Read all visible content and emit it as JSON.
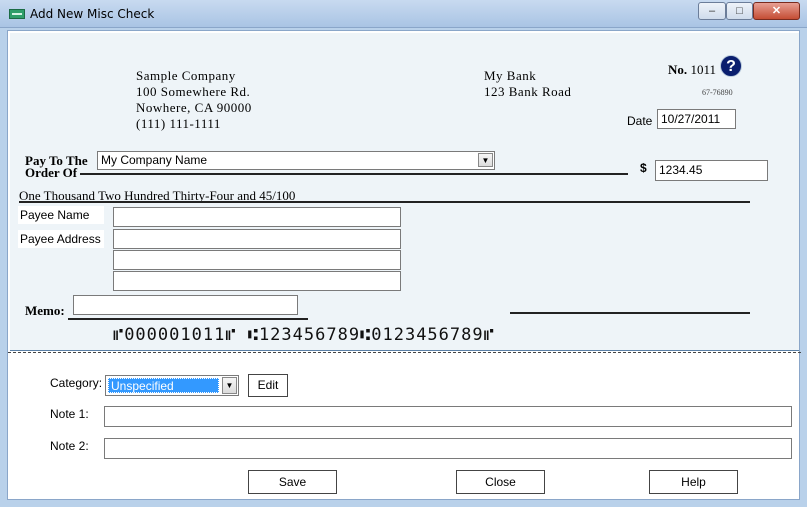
{
  "window": {
    "title": "Add New Misc Check",
    "controls": {
      "minimize": "–",
      "maximize": "□",
      "close": "✕"
    }
  },
  "company": {
    "name": "Sample Company",
    "address1": "100 Somewhere Rd.",
    "address2": "Nowhere, CA 90000",
    "phone": "(111) 111-1111"
  },
  "bank": {
    "name": "My Bank",
    "address": "123 Bank Road"
  },
  "check": {
    "number_label": "No.",
    "number": "1011",
    "help_glyph": "?",
    "routing_fraction": "67-76890",
    "date_label": "Date",
    "date": "10/27/2011",
    "pay_to_label_1": "Pay To The",
    "pay_to_label_2": "Order Of",
    "payee": "My Company Name",
    "dollar_sign": "$",
    "amount": "1234.45",
    "amount_words": "One Thousand Two Hundred Thirty-Four and 45/100",
    "payee_name_label": "Payee Name",
    "payee_address_label": "Payee Address",
    "payee_name": "",
    "payee_address_1": "",
    "payee_address_2": "",
    "payee_address_3": "",
    "memo_label": "Memo:",
    "memo": "",
    "micr_line": "⑈000001011⑈ ⑆123456789⑆0123456789⑈"
  },
  "details": {
    "category_label": "Category:",
    "category_value": "Unspecified",
    "edit_label": "Edit",
    "note1_label": "Note 1:",
    "note1_value": "",
    "note2_label": "Note 2:",
    "note2_value": ""
  },
  "buttons": {
    "save": "Save",
    "close": "Close",
    "help": "Help"
  },
  "icons": {
    "app_icon": "check-icon",
    "help_icon": "help-circle-icon",
    "dropdown_arrow": "▼"
  }
}
